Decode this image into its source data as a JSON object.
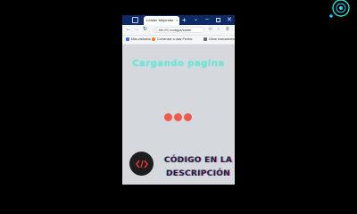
{
  "browser": {
    "tab_title": "Loader Mejorado",
    "tab_close": "×",
    "new_tab": "+",
    "tab_list": "⌄",
    "minimize": "–",
    "close": "✕",
    "address": "file:///C:/codigos/loader",
    "bookmarks": [
      {
        "label": "Más visitados",
        "color": "#3b6fe0"
      },
      {
        "label": "Comenzar a usar Firefox",
        "color": "#f07a25"
      },
      {
        "label": "Otros marcadores",
        "color": "#6a6a6a"
      }
    ]
  },
  "page": {
    "title": "Cargando pagina",
    "dot_color": "#f15a4a",
    "cta_line1": "CÓDIGO EN LA",
    "cta_line2": "DESCRIPCIÓN",
    "code_icon": "</>"
  },
  "colors": {
    "accent": "#7ee1d6",
    "tabbar": "#0e2a66",
    "page_bg": "#d5d9de"
  }
}
